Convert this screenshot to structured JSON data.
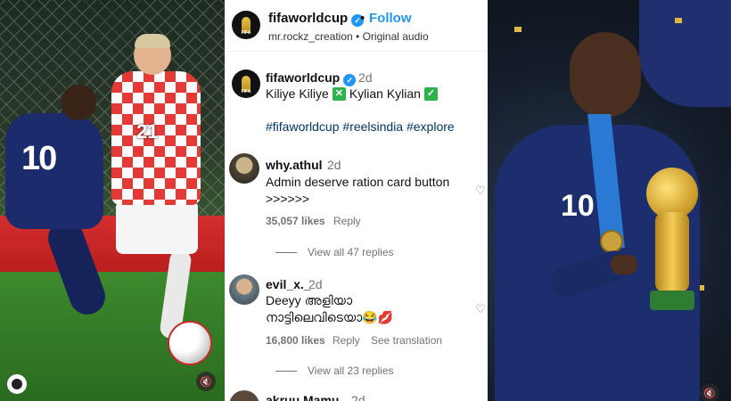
{
  "header": {
    "account": "fifaworldcup",
    "follow_label": "Follow",
    "separator": "•",
    "audio": "mr.rockz_creation • Original audio"
  },
  "caption": {
    "account": "fifaworldcup",
    "time": "2d",
    "part1": "Kiliye Kiliye",
    "part2": "Kylian Kylian",
    "hashtags": "#fifaworldcup #reelsindia #explore"
  },
  "comments": [
    {
      "user": "why.athul",
      "time": "2d",
      "text_line1": "Admin deserve ration card button",
      "text_line2": ">>>>>>",
      "likes": "35,057 likes",
      "reply_label": "Reply",
      "view_replies": "View all 47 replies"
    },
    {
      "user": "evil_x._",
      "time": "2d",
      "text_line1": "Deeyy അളിയാ",
      "text_line2": "നാട്ടിലെവിടെയാ😂💋",
      "likes": "16,800 likes",
      "reply_label": "Reply",
      "translate_label": "See translation",
      "view_replies": "View all 23 replies"
    },
    {
      "user": "akruu.Mamu",
      "time": "2d"
    }
  ],
  "media": {
    "left_jersey_number": "10",
    "left_opponent_number": "21",
    "right_jersey_number": "10"
  },
  "colors": {
    "link_blue": "#1f96f3",
    "hashtag": "#00376b",
    "muted": "#737373",
    "check_green": "#2eb34a"
  }
}
